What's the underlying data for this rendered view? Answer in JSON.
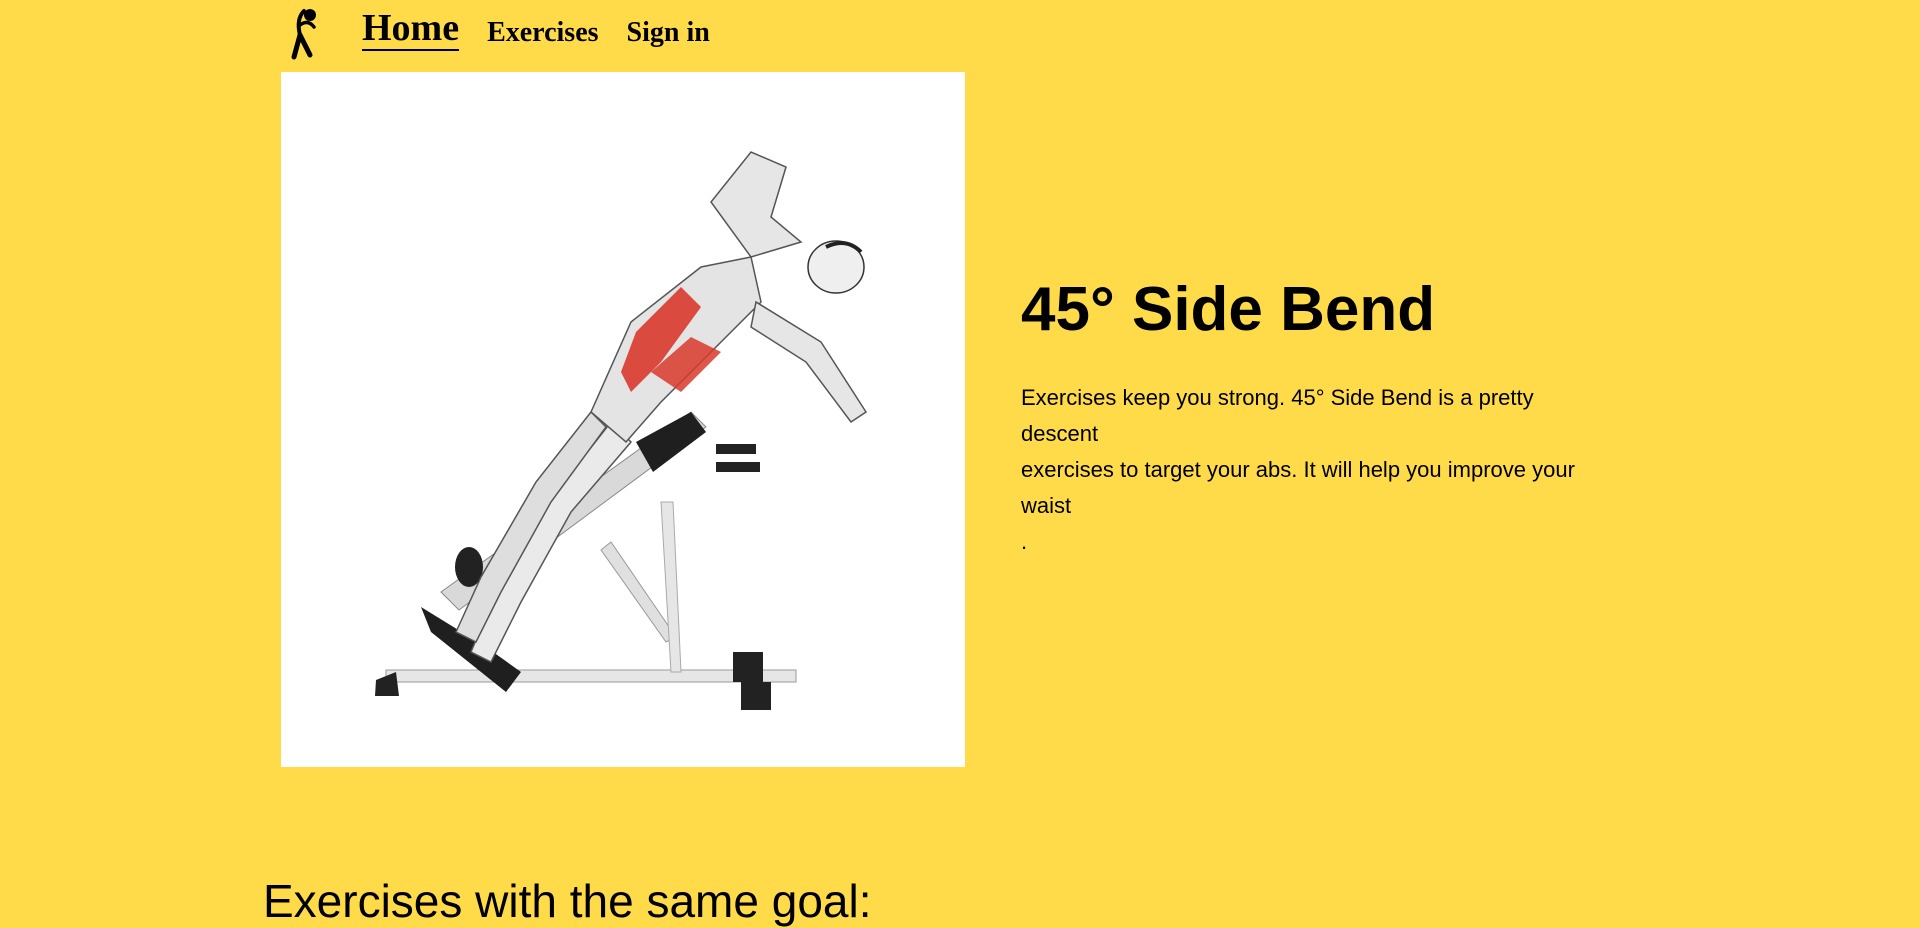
{
  "nav": {
    "logo_icon": "stretching-person-icon",
    "items": [
      "Home",
      "Exercises",
      "Sign in"
    ],
    "active": "Home"
  },
  "exercise": {
    "name": "45° Side Bend",
    "description_lines": [
      "Exercises keep you strong. 45° Side Bend is a pretty descent",
      "exercises to target your abs. It will help you improve your waist",
      "."
    ],
    "image_icon": "exercise-illustration"
  },
  "related": {
    "heading": "Exercises with the same goal:"
  },
  "colors": {
    "background": "#FFDB4A",
    "text": "#000000",
    "muscle_highlight": "#D9382B"
  }
}
